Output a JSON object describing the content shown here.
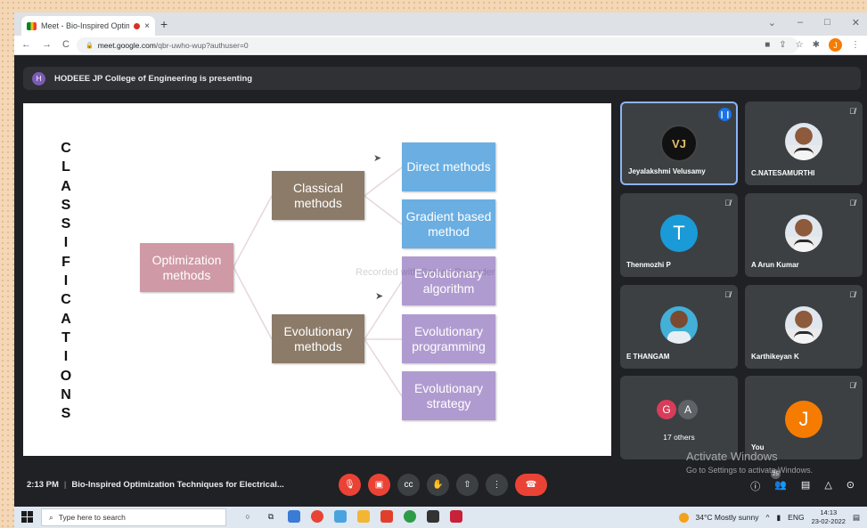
{
  "browser": {
    "tab_title": "Meet - Bio-Inspired Optimiz",
    "tab_close": "×",
    "new_tab": "+",
    "url_host": "meet.google.com",
    "url_path": "/qbr-uwho-wup?authuser=0",
    "profile_initial": "J",
    "window_controls": [
      "⌄",
      "–",
      "□",
      "✕"
    ],
    "nav": [
      "←",
      "→",
      "C"
    ]
  },
  "meet": {
    "presenter_initial": "H",
    "presenting_text": "HODEEE JP College of Engineering is presenting",
    "watermark": "Recorded with Screen Recorder",
    "meeting_time": "2:13 PM",
    "meeting_title": "Bio-Inspired Optimization Techniques for Electrical...",
    "participant_count": "25",
    "activate_title": "Activate Windows",
    "activate_sub": "Go to Settings to activate Windows."
  },
  "slide": {
    "vertical_text": [
      "C",
      "L",
      "A",
      "S",
      "S",
      "I",
      "F",
      "I",
      "C",
      "A",
      "T",
      "I",
      "O",
      "N",
      "S"
    ],
    "root": "Optimization methods",
    "classical": "Classical methods",
    "evolutionary": "Evolutionary methods",
    "direct": "Direct methods",
    "gradient": "Gradient based method",
    "evo_algorithm": "Evolutionary algorithm",
    "evo_programming": "Evolutionary programming",
    "evo_strategy": "Evolutionary strategy"
  },
  "participants": [
    {
      "name": "Jeyalakshmi Velusamy",
      "avatar": "VJ",
      "speaking": true
    },
    {
      "name": "C.NATESAMURTHI",
      "avatar": "photo"
    },
    {
      "name": "Thenmozhi P",
      "avatar": "T",
      "color": "#1a9bd7"
    },
    {
      "name": "A Arun Kumar",
      "avatar": "photo"
    },
    {
      "name": "E THANGAM",
      "avatar": "photo"
    },
    {
      "name": "Karthikeyan K",
      "avatar": "photo"
    },
    {
      "name": "17 others",
      "avatars": [
        "G",
        "A"
      ],
      "colors": [
        "#d93c5a",
        "#5f6368"
      ]
    },
    {
      "name": "You",
      "avatar": "J",
      "color": "#f57c00"
    }
  ],
  "taskbar": {
    "search_placeholder": "Type here to search",
    "weather": "34°C  Mostly sunny",
    "lang": "ENG",
    "time": "14:13",
    "date": "23-02-2022"
  }
}
